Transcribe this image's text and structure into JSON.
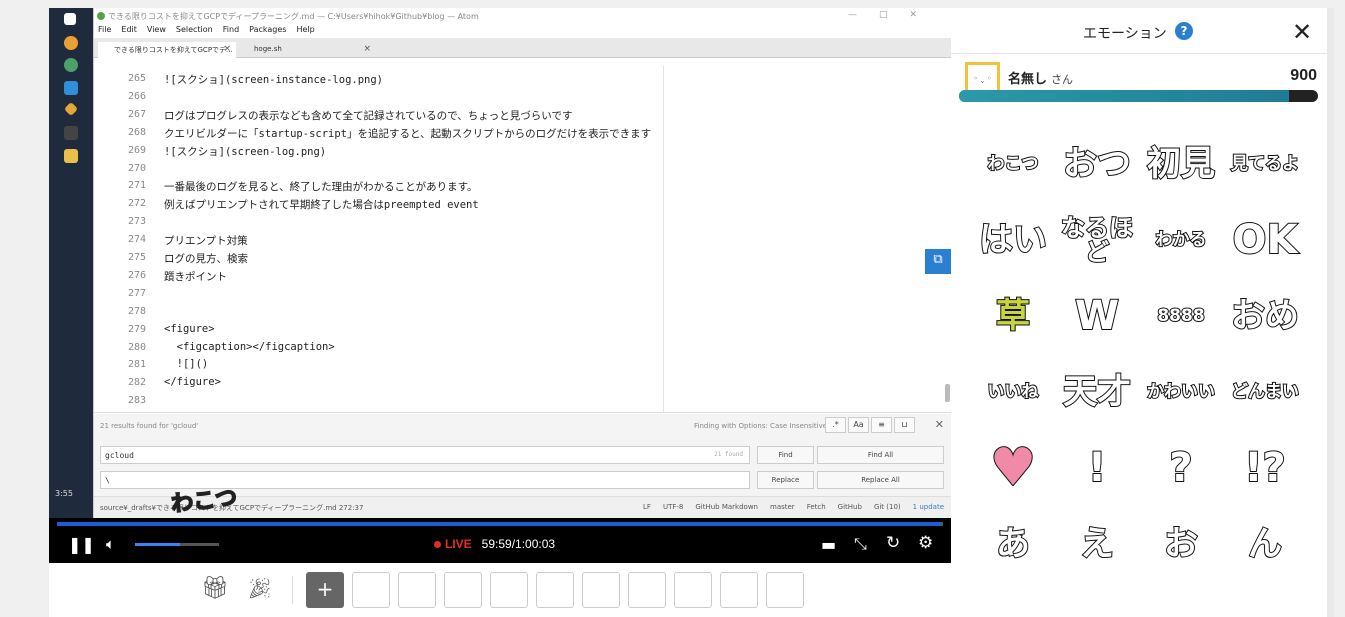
{
  "atom": {
    "title": "できる限りコストを抑えてGCPでディープラーニング.md — C:¥Users¥hihok¥Github¥blog — Atom",
    "menu": [
      "File",
      "Edit",
      "View",
      "Selection",
      "Find",
      "Packages",
      "Help"
    ],
    "tabs": [
      {
        "label": "できる限りコストを抑えてGCPでデ..."
      },
      {
        "label": "hoge.sh"
      }
    ],
    "lines": [
      {
        "n": "265",
        "t": "![スクショ](screen-instance-log.png)"
      },
      {
        "n": "266",
        "t": ""
      },
      {
        "n": "267",
        "t": "ログはプログレスの表示なども含めて全て記録されているので、ちょっと見づらいです"
      },
      {
        "n": "268",
        "t": "クエリビルダーに「startup-script」を追記すると、起動スクリプトからのログだけを表示できます"
      },
      {
        "n": "269",
        "t": "![スクショ](screen-log.png)"
      },
      {
        "n": "270",
        "t": ""
      },
      {
        "n": "271",
        "t": "一番最後のログを見ると、終了した理由がわかることがあります。"
      },
      {
        "n": "272",
        "t": "例えばプリエンプトされて早期終了した場合はpreempted event"
      },
      {
        "n": "273",
        "t": ""
      },
      {
        "n": "274",
        "t": "プリエンプト対策"
      },
      {
        "n": "275",
        "t": "ログの見方、検索"
      },
      {
        "n": "276",
        "t": "躓きポイント"
      },
      {
        "n": "277",
        "t": ""
      },
      {
        "n": "278",
        "t": ""
      },
      {
        "n": "279",
        "t": "<figure>"
      },
      {
        "n": "280",
        "t": "  <figcaption></figcaption>"
      },
      {
        "n": "281",
        "t": "  ![]()"
      },
      {
        "n": "282",
        "t": "</figure>"
      },
      {
        "n": "283",
        "t": ""
      }
    ],
    "find": {
      "results": "21 results found for 'gcloud'",
      "options": "Finding with Options: Case Insensitive",
      "option_buttons": [
        ".*",
        "Aa",
        "≡",
        "⊔"
      ],
      "query": "gcloud",
      "count": "21 found",
      "replace_value": "\\",
      "find_label": "Find",
      "find_all_label": "Find All",
      "replace_label": "Replace",
      "replace_all_label": "Replace All"
    },
    "status": {
      "path": "source¥_drafts¥できる限りコストを抑えてGCPでディープラーニング.md   272:37",
      "items": [
        "LF",
        "UTF-8",
        "GitHub Markdown",
        "master",
        "Fetch",
        "GitHub",
        "Git (10)",
        "1 update"
      ]
    },
    "clock": "3:55",
    "overlay_emote": "わこつ"
  },
  "player": {
    "live_label": "LIVE",
    "time": "59:59/1:00:03",
    "progress": 0.998,
    "volume": 0.53
  },
  "toolbar": {
    "slot_count": 10
  },
  "panel": {
    "title": "エモーション",
    "user_name": "名無し",
    "user_suffix": "さん",
    "avatar_face": "◦ ˬ ◦",
    "points": "900",
    "gauge": 0.92,
    "emotes": [
      {
        "text": "わこつ",
        "size": "small"
      },
      {
        "text": "おつ",
        "size": "big"
      },
      {
        "text": "初見",
        "size": "big"
      },
      {
        "text": "見てるよ",
        "size": "small"
      },
      {
        "text": "はい",
        "size": "big"
      },
      {
        "text": "なるほど",
        "size": "mid"
      },
      {
        "text": "わかる",
        "size": "small"
      },
      {
        "text": "OK",
        "size": "ok"
      },
      {
        "text": "草",
        "size": "grass"
      },
      {
        "text": "W",
        "size": "ok"
      },
      {
        "text": "8888",
        "size": "small"
      },
      {
        "text": "おめ",
        "size": "big"
      },
      {
        "text": "いいね",
        "size": "small"
      },
      {
        "text": "天才",
        "size": "big"
      },
      {
        "text": "かわいい",
        "size": "small"
      },
      {
        "text": "どんまい",
        "size": "small"
      },
      {
        "text": "♥",
        "size": "heart"
      },
      {
        "text": "!",
        "size": "ok"
      },
      {
        "text": "?",
        "size": "ok"
      },
      {
        "text": "!?",
        "size": "ok"
      },
      {
        "text": "あ",
        "size": "big"
      },
      {
        "text": "え",
        "size": "big"
      },
      {
        "text": "お",
        "size": "big"
      },
      {
        "text": "ん",
        "size": "big"
      }
    ]
  },
  "colors": {
    "accent": "#2b7fd0",
    "live": "#e42b2b",
    "gauge": "#2a9aa9",
    "grass": "#c8d63c",
    "heart": "#f08aa8"
  },
  "icons": {
    "pause": "pause-icon",
    "volume": "volume-icon",
    "comment": "comment-icon",
    "fullscreen": "fullscreen-icon",
    "reload": "reload-icon",
    "settings": "gear-icon",
    "gift": "gift-icon",
    "emotion": "party-popper-icon",
    "add": "plus-icon",
    "help": "help-icon",
    "close": "close-icon"
  }
}
